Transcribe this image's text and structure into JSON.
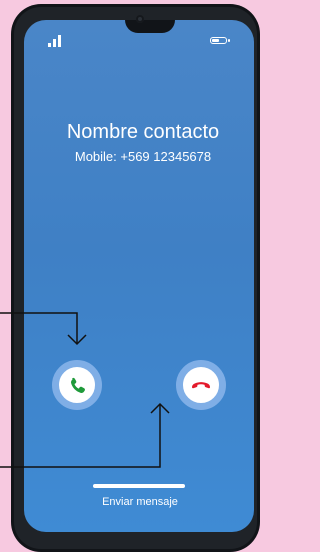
{
  "call_screen": {
    "contact_name": "Nombre contacto",
    "contact_number": "Mobile: +569 12345678",
    "send_message_label": "Enviar mensaje"
  },
  "status_bar": {
    "signal_icon": "signal-bars-icon",
    "battery_icon": "battery-icon",
    "battery_level": 0.6
  },
  "actions": {
    "answer_icon": "phone-answer-icon",
    "decline_icon": "phone-hangup-icon"
  },
  "colors": {
    "background": "#f7c9e0",
    "screen": "#3f80c5",
    "answer": "#1f9a3a",
    "decline": "#e3192b",
    "button_ring": "#7faee6"
  }
}
